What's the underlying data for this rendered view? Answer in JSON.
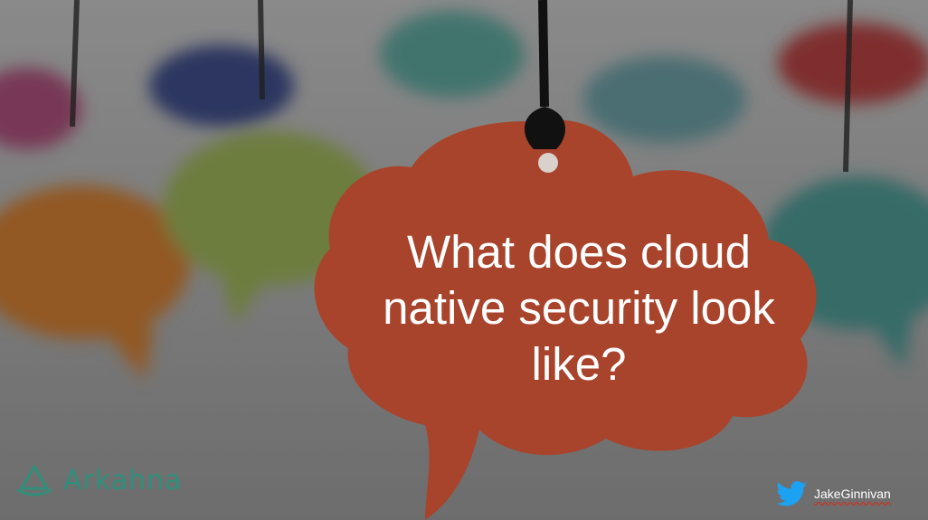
{
  "slide": {
    "title_lines": [
      "What does cloud",
      "native security look",
      "like?"
    ]
  },
  "logo": {
    "icon": "arkahna-logo-icon",
    "text": "Arkahna",
    "color": "#2f8f7c"
  },
  "twitter": {
    "icon": "twitter-bird-icon",
    "handle": "JakeGinnivan",
    "color": "#1da1f2"
  },
  "colors": {
    "main_bubble": "#a8442c",
    "overlay_dim": "rgba(40,40,40,0.35)"
  }
}
